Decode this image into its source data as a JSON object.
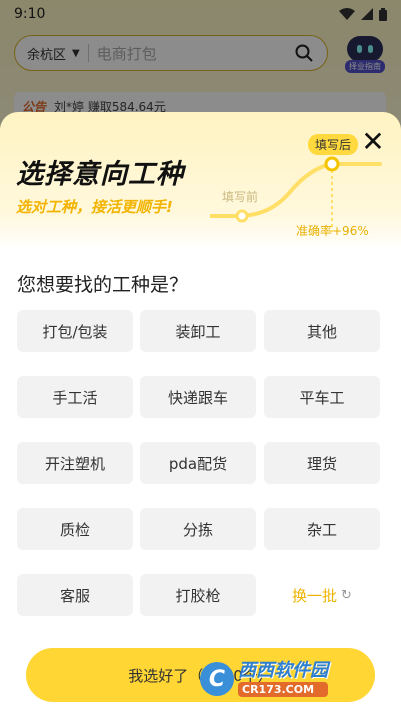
{
  "status_bar": {
    "time": "9:10"
  },
  "search": {
    "district": "余杭区",
    "placeholder": "电商打包"
  },
  "robot": {
    "label": "择业指南"
  },
  "notice": {
    "tag": "公告",
    "text": "刘*婷 赚取584.64元"
  },
  "sheet": {
    "title": "选择意向工种",
    "subtitle": "选对工种，接活更顺手!",
    "graph": {
      "before_label": "填写前",
      "after_label": "填写后",
      "accuracy_label": "准确率+96%"
    },
    "question": "您想要找的工种是？",
    "job_types": [
      "打包/包装",
      "装卸工",
      "其他",
      "手工活",
      "快递跟车",
      "平车工",
      "开注塑机",
      "pda配货",
      "理货",
      "质检",
      "分拣",
      "杂工",
      "客服",
      "打胶枪"
    ],
    "refresh_label": "换一批",
    "confirm_label": "我选好了（已选0个）"
  },
  "watermark": {
    "logo": "C",
    "name": "西西软件园",
    "site": "CR173.COM"
  },
  "colors": {
    "accent": "#ffd633",
    "accent_text": "#f0b400",
    "chip_bg": "#f2f2f2"
  }
}
